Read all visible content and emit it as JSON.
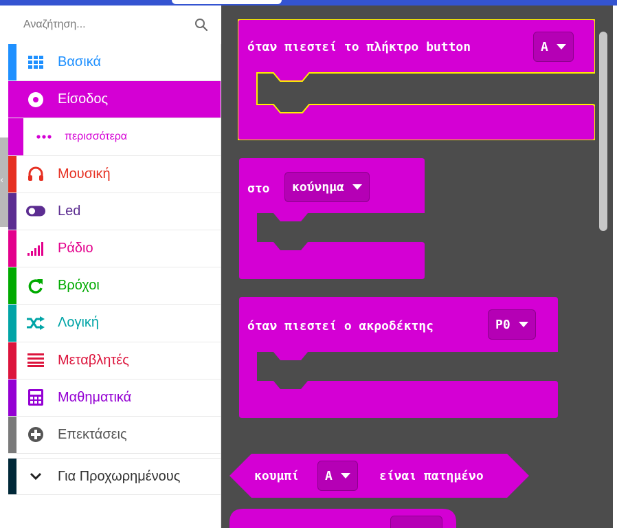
{
  "search": {
    "placeholder": "Αναζήτηση...",
    "icon": "search-icon"
  },
  "side_tab_glyph": "‹",
  "categories": [
    {
      "label": "Βασικά",
      "color": "#1e90ff",
      "icon": "grid-icon"
    },
    {
      "label": "Είσοδος",
      "color": "#d400d4",
      "icon": "target-icon",
      "selected": true
    },
    {
      "label": "περισσότερα",
      "color": "#d400d4",
      "icon": "more-dots-icon",
      "sub": true
    },
    {
      "label": "Μουσική",
      "color": "#e63022",
      "icon": "headphones-icon"
    },
    {
      "label": "Led",
      "color": "#5c2d91",
      "icon": "toggle-icon"
    },
    {
      "label": "Ράδιο",
      "color": "#e3008c",
      "icon": "signal-bars-icon"
    },
    {
      "label": "Βρόχοι",
      "color": "#00aa00",
      "icon": "refresh-icon"
    },
    {
      "label": "Λογική",
      "color": "#00a4a6",
      "icon": "shuffle-icon"
    },
    {
      "label": "Μεταβλητές",
      "color": "#dc143c",
      "icon": "lines-icon"
    },
    {
      "label": "Μαθηματικά",
      "color": "#9400d3",
      "icon": "calculator-icon"
    },
    {
      "label": "Επεκτάσεις",
      "color": "#7a7a7a",
      "icon": "plus-circle-icon"
    }
  ],
  "advanced": {
    "label": "Για Προχωρημένους",
    "icon": "chevron-down-icon",
    "color": "#002838"
  },
  "blocks": {
    "button_pressed": {
      "text": "όταν πιεστεί το πλήκτρο button",
      "dropdown": "A"
    },
    "gesture": {
      "text": "στο",
      "dropdown": "κούνημα"
    },
    "pin_pressed": {
      "text": "όταν πιεστεί ο ακροδέκτης",
      "dropdown": "P0"
    },
    "is_pressed": {
      "text_before": "κουμπί",
      "dropdown": "A",
      "text_after": "είναι πατημένο"
    }
  },
  "colors": {
    "input_category": "#d400d4",
    "workspace": "#4c4c4c",
    "block_border_highlight": "#ffee00"
  }
}
